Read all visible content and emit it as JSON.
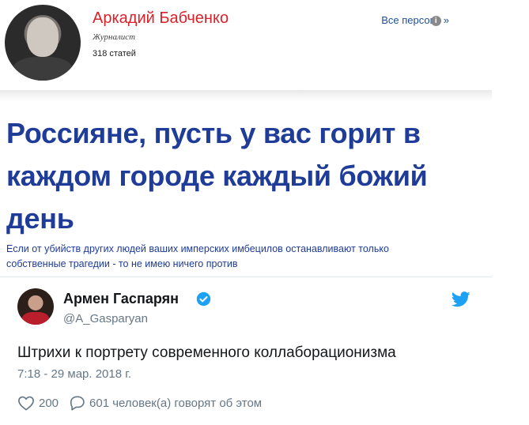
{
  "author": {
    "name": "Аркадий Бабченко",
    "role": "Журналист",
    "count": "318 статей",
    "all_link": "Все персон",
    "all_link_info": "i",
    "all_link_arrow": "»"
  },
  "article": {
    "headline": "Россияне, пусть у вас горит в каждом городе каждый божий день",
    "subtitle": "Если от убийств других людей ваших имперских имбецилов останавливают только собственные трагедии - то не имею ничего против"
  },
  "tweet": {
    "name": "Армен Гаспарян",
    "handle": "@A_Gasparyan",
    "text": "Штрихи к портрету современного коллаборационизма",
    "date": "7:18 - 29 мар. 2018 г.",
    "likes": "200",
    "replies": "601 человек(а) говорят об этом"
  },
  "colors": {
    "author_red": "#d8222a",
    "headline_blue": "#1f3c98",
    "twitter_blue": "#1da1f2",
    "muted_gray": "#657786"
  },
  "icons": [
    "avatar",
    "info-icon",
    "verified-icon",
    "twitter-icon",
    "heart-icon",
    "reply-icon"
  ]
}
